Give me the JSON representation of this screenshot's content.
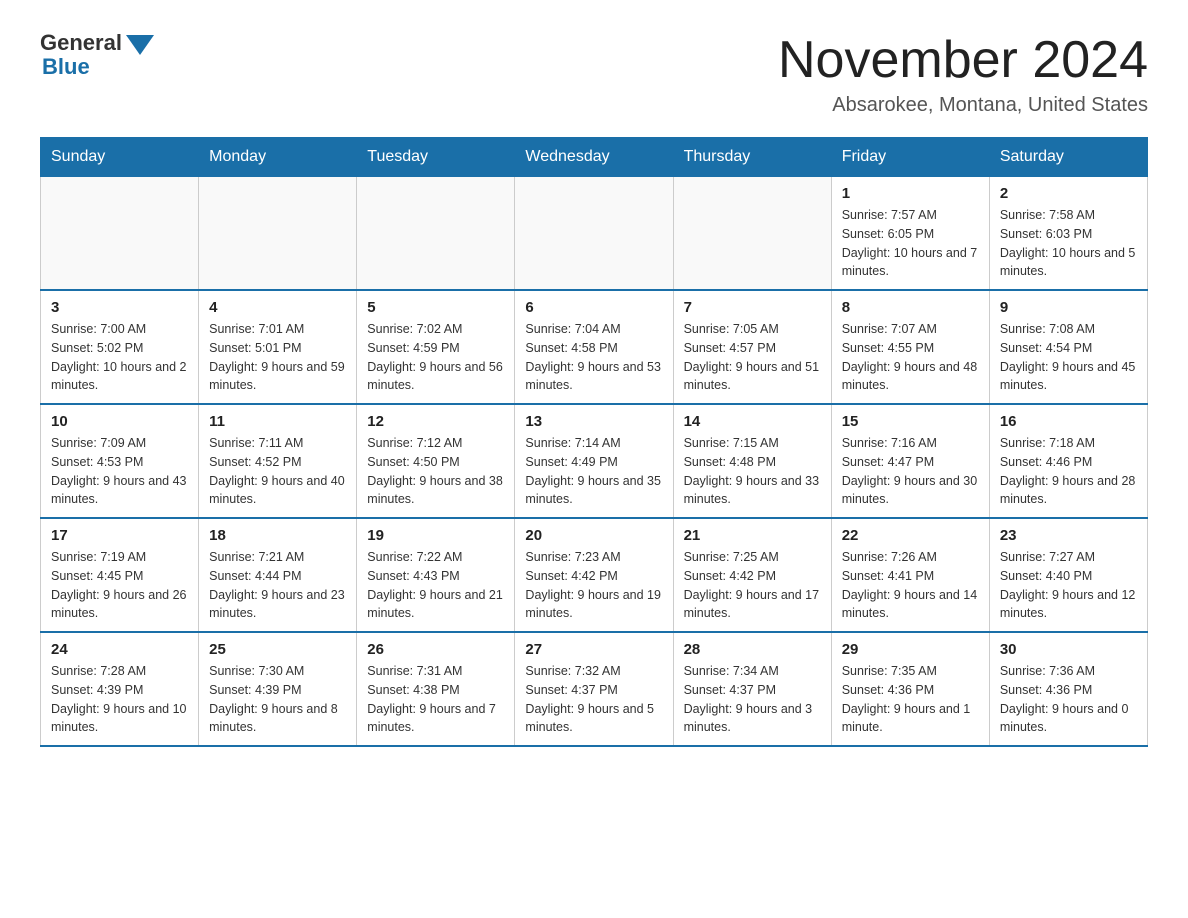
{
  "logo": {
    "general": "General",
    "blue": "Blue"
  },
  "title": "November 2024",
  "location": "Absarokee, Montana, United States",
  "weekdays": [
    "Sunday",
    "Monday",
    "Tuesday",
    "Wednesday",
    "Thursday",
    "Friday",
    "Saturday"
  ],
  "rows": [
    [
      {
        "day": "",
        "info": ""
      },
      {
        "day": "",
        "info": ""
      },
      {
        "day": "",
        "info": ""
      },
      {
        "day": "",
        "info": ""
      },
      {
        "day": "",
        "info": ""
      },
      {
        "day": "1",
        "info": "Sunrise: 7:57 AM\nSunset: 6:05 PM\nDaylight: 10 hours and 7 minutes."
      },
      {
        "day": "2",
        "info": "Sunrise: 7:58 AM\nSunset: 6:03 PM\nDaylight: 10 hours and 5 minutes."
      }
    ],
    [
      {
        "day": "3",
        "info": "Sunrise: 7:00 AM\nSunset: 5:02 PM\nDaylight: 10 hours and 2 minutes."
      },
      {
        "day": "4",
        "info": "Sunrise: 7:01 AM\nSunset: 5:01 PM\nDaylight: 9 hours and 59 minutes."
      },
      {
        "day": "5",
        "info": "Sunrise: 7:02 AM\nSunset: 4:59 PM\nDaylight: 9 hours and 56 minutes."
      },
      {
        "day": "6",
        "info": "Sunrise: 7:04 AM\nSunset: 4:58 PM\nDaylight: 9 hours and 53 minutes."
      },
      {
        "day": "7",
        "info": "Sunrise: 7:05 AM\nSunset: 4:57 PM\nDaylight: 9 hours and 51 minutes."
      },
      {
        "day": "8",
        "info": "Sunrise: 7:07 AM\nSunset: 4:55 PM\nDaylight: 9 hours and 48 minutes."
      },
      {
        "day": "9",
        "info": "Sunrise: 7:08 AM\nSunset: 4:54 PM\nDaylight: 9 hours and 45 minutes."
      }
    ],
    [
      {
        "day": "10",
        "info": "Sunrise: 7:09 AM\nSunset: 4:53 PM\nDaylight: 9 hours and 43 minutes."
      },
      {
        "day": "11",
        "info": "Sunrise: 7:11 AM\nSunset: 4:52 PM\nDaylight: 9 hours and 40 minutes."
      },
      {
        "day": "12",
        "info": "Sunrise: 7:12 AM\nSunset: 4:50 PM\nDaylight: 9 hours and 38 minutes."
      },
      {
        "day": "13",
        "info": "Sunrise: 7:14 AM\nSunset: 4:49 PM\nDaylight: 9 hours and 35 minutes."
      },
      {
        "day": "14",
        "info": "Sunrise: 7:15 AM\nSunset: 4:48 PM\nDaylight: 9 hours and 33 minutes."
      },
      {
        "day": "15",
        "info": "Sunrise: 7:16 AM\nSunset: 4:47 PM\nDaylight: 9 hours and 30 minutes."
      },
      {
        "day": "16",
        "info": "Sunrise: 7:18 AM\nSunset: 4:46 PM\nDaylight: 9 hours and 28 minutes."
      }
    ],
    [
      {
        "day": "17",
        "info": "Sunrise: 7:19 AM\nSunset: 4:45 PM\nDaylight: 9 hours and 26 minutes."
      },
      {
        "day": "18",
        "info": "Sunrise: 7:21 AM\nSunset: 4:44 PM\nDaylight: 9 hours and 23 minutes."
      },
      {
        "day": "19",
        "info": "Sunrise: 7:22 AM\nSunset: 4:43 PM\nDaylight: 9 hours and 21 minutes."
      },
      {
        "day": "20",
        "info": "Sunrise: 7:23 AM\nSunset: 4:42 PM\nDaylight: 9 hours and 19 minutes."
      },
      {
        "day": "21",
        "info": "Sunrise: 7:25 AM\nSunset: 4:42 PM\nDaylight: 9 hours and 17 minutes."
      },
      {
        "day": "22",
        "info": "Sunrise: 7:26 AM\nSunset: 4:41 PM\nDaylight: 9 hours and 14 minutes."
      },
      {
        "day": "23",
        "info": "Sunrise: 7:27 AM\nSunset: 4:40 PM\nDaylight: 9 hours and 12 minutes."
      }
    ],
    [
      {
        "day": "24",
        "info": "Sunrise: 7:28 AM\nSunset: 4:39 PM\nDaylight: 9 hours and 10 minutes."
      },
      {
        "day": "25",
        "info": "Sunrise: 7:30 AM\nSunset: 4:39 PM\nDaylight: 9 hours and 8 minutes."
      },
      {
        "day": "26",
        "info": "Sunrise: 7:31 AM\nSunset: 4:38 PM\nDaylight: 9 hours and 7 minutes."
      },
      {
        "day": "27",
        "info": "Sunrise: 7:32 AM\nSunset: 4:37 PM\nDaylight: 9 hours and 5 minutes."
      },
      {
        "day": "28",
        "info": "Sunrise: 7:34 AM\nSunset: 4:37 PM\nDaylight: 9 hours and 3 minutes."
      },
      {
        "day": "29",
        "info": "Sunrise: 7:35 AM\nSunset: 4:36 PM\nDaylight: 9 hours and 1 minute."
      },
      {
        "day": "30",
        "info": "Sunrise: 7:36 AM\nSunset: 4:36 PM\nDaylight: 9 hours and 0 minutes."
      }
    ]
  ]
}
